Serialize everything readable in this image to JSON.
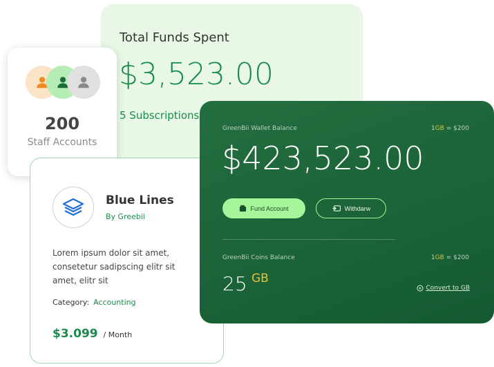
{
  "funds": {
    "title": "Total Funds Spent",
    "amount": "$3,523.00",
    "subscriptions": "5 Subscriptions"
  },
  "staff": {
    "count": "200",
    "label": "Staff Accounts"
  },
  "product": {
    "title": "Blue Lines",
    "by": "By Greebii",
    "description": "Lorem ipsum dolor sit amet, consetetur sadipscing elitr sit amet, elitr sit",
    "category_label": "Category:",
    "category_value": "Accounting",
    "price": "$3.099",
    "period": "/ Month"
  },
  "wallet": {
    "balance_label": "GreenBii Wallet Balance",
    "rate_prefix": "1",
    "rate_unit": "GB",
    "rate_suffix": " = $200",
    "balance_amount": "$423,523.00",
    "fund_button": "Fund Account",
    "withdraw_button": "Withdarw",
    "coins_label": "GreenBii Coins Balance",
    "coins_rate_prefix": "1",
    "coins_rate_unit": "GB",
    "coins_rate_suffix": " = $200",
    "coins_amount": "25",
    "coins_unit": "GB",
    "convert_link": "Convert to GB"
  },
  "colors": {
    "brand_green": "#198c4a",
    "dark_green": "#1c6438",
    "light_green": "#a7f59a",
    "gold": "#e1c33a"
  },
  "icons": [
    "user-orange-icon",
    "user-green-icon",
    "user-gray-icon",
    "layers-icon",
    "wallet-icon",
    "withdraw-icon",
    "coin-icon"
  ]
}
